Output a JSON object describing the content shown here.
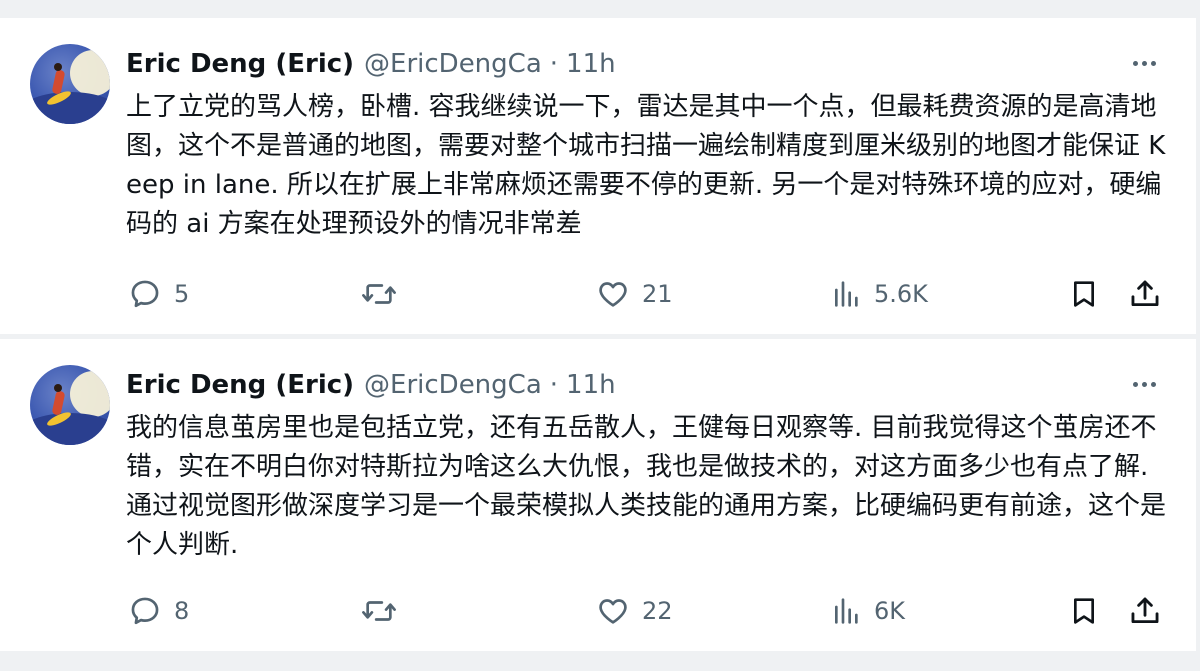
{
  "tweets": [
    {
      "author": {
        "name": "Eric Deng (Eric)",
        "handle": "@EricDengCa",
        "separator": "·",
        "time": "11h"
      },
      "text": "上了立党的骂人榜，卧槽. 容我继续说一下，雷达是其中一个点，但最耗费资源的是高清地图，这个不是普通的地图，需要对整个城市扫描一遍绘制精度到厘米级别的地图才能保证 Keep in lane. 所以在扩展上非常麻烦还需要不停的更新. 另一个是对特殊环境的应对，硬编码的 ai 方案在处理预设外的情况非常差",
      "stats": {
        "replies": "5",
        "reposts": "",
        "likes": "21",
        "views": "5.6K"
      }
    },
    {
      "author": {
        "name": "Eric Deng (Eric)",
        "handle": "@EricDengCa",
        "separator": "·",
        "time": "11h"
      },
      "text": "我的信息茧房里也是包括立党，还有五岳散人，王健每日观察等. 目前我觉得这个茧房还不错，实在不明白你对特斯拉为啥这么大仇恨，我也是做技术的，对这方面多少也有点了解. 通过视觉图形做深度学习是一个最荣模拟人类技能的通用方案，比硬编码更有前途，这个是个人判断.",
      "stats": {
        "replies": "8",
        "reposts": "",
        "likes": "22",
        "views": "6K"
      }
    }
  ],
  "icons": {
    "more": "more-horizontal-icon",
    "reply": "reply-icon",
    "repost": "repost-icon",
    "like": "heart-icon",
    "views": "views-chart-icon",
    "bookmark": "bookmark-icon",
    "share": "share-icon"
  },
  "colors": {
    "text_primary": "#0f1419",
    "text_secondary": "#536471",
    "background": "#ffffff",
    "separator": "#eff1f3"
  }
}
